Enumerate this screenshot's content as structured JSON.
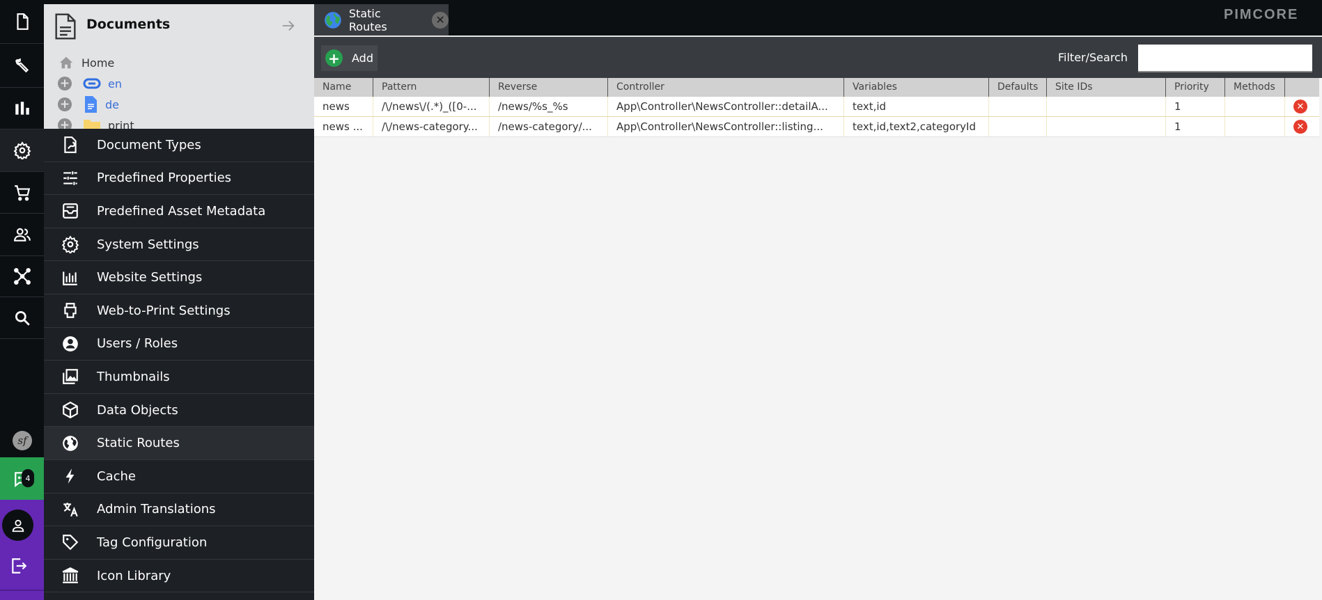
{
  "sidebar": {
    "icons": [
      "documents-icon",
      "tools-icon",
      "reports-icon",
      "settings-icon",
      "ecommerce-icon",
      "users-icon",
      "data-hub-icon",
      "search-icon"
    ],
    "symfony_icon": "symfony-icon",
    "notifications_badge": "4",
    "user_icon": "user-icon",
    "logout_icon": "logout-icon"
  },
  "documents_panel": {
    "title": "Documents",
    "tree": [
      {
        "label": "Home",
        "icon": "home-icon"
      },
      {
        "label": "en",
        "icon": "link-icon"
      },
      {
        "label": "de",
        "icon": "page-icon"
      },
      {
        "label": "print",
        "icon": "folder-icon"
      }
    ]
  },
  "settings_menu": {
    "items": [
      {
        "label": "Document Types",
        "icon": "document-types-icon",
        "submenu": false,
        "active": false
      },
      {
        "label": "Predefined Properties",
        "icon": "sliders-icon",
        "submenu": false,
        "active": false
      },
      {
        "label": "Predefined Asset Metadata",
        "icon": "metadata-icon",
        "submenu": false,
        "active": false
      },
      {
        "label": "System Settings",
        "icon": "gear-icon",
        "submenu": false,
        "active": false
      },
      {
        "label": "Website Settings",
        "icon": "website-settings-icon",
        "submenu": false,
        "active": false
      },
      {
        "label": "Web-to-Print Settings",
        "icon": "printer-icon",
        "submenu": false,
        "active": false
      },
      {
        "label": "Users / Roles",
        "icon": "user-circle-icon",
        "submenu": true,
        "active": false
      },
      {
        "label": "Thumbnails",
        "icon": "images-icon",
        "submenu": true,
        "active": false
      },
      {
        "label": "Data Objects",
        "icon": "cube-icon",
        "submenu": true,
        "active": false
      },
      {
        "label": "Static Routes",
        "icon": "globe-icon",
        "submenu": false,
        "active": true
      },
      {
        "label": "Cache",
        "icon": "bolt-icon",
        "submenu": true,
        "active": false
      },
      {
        "label": "Admin Translations",
        "icon": "translate-icon",
        "submenu": false,
        "active": false
      },
      {
        "label": "Tag Configuration",
        "icon": "tag-icon",
        "submenu": false,
        "active": false
      },
      {
        "label": "Icon Library",
        "icon": "library-icon",
        "submenu": false,
        "active": false
      }
    ]
  },
  "tabs": [
    {
      "label": "Static Routes",
      "icon": "globe-icon"
    }
  ],
  "brand": "PIMCORE",
  "toolbar": {
    "add_label": "Add",
    "filter_label": "Filter/Search",
    "filter_value": ""
  },
  "grid": {
    "columns": [
      "Name",
      "Pattern",
      "Reverse",
      "Controller",
      "Variables",
      "Defaults",
      "Site IDs",
      "Priority",
      "Methods",
      ""
    ],
    "rows": [
      [
        "news",
        "/\\/news\\/(.*)_([0-...",
        "/news/%s_%s",
        "App\\Controller\\NewsController::detailA...",
        "text,id",
        "",
        "",
        "1",
        ""
      ],
      [
        "news ...",
        "/\\/news-category...",
        "/news-category/...",
        "App\\Controller\\NewsController::listing...",
        "text,id,text2,categoryId",
        "",
        "",
        "1",
        ""
      ]
    ]
  }
}
